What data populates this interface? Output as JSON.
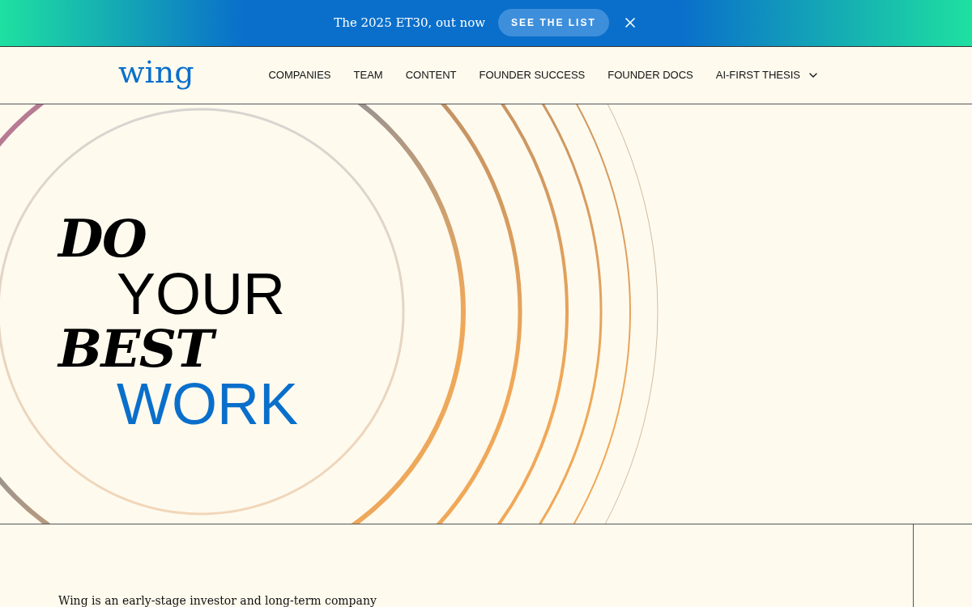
{
  "banner": {
    "text": "The 2025 ET30, out now",
    "button": "SEE THE LIST"
  },
  "header": {
    "logo": "wing",
    "nav": [
      {
        "label": "COMPANIES",
        "dropdown": false
      },
      {
        "label": "TEAM",
        "dropdown": false
      },
      {
        "label": "CONTENT",
        "dropdown": false
      },
      {
        "label": "FOUNDER SUCCESS",
        "dropdown": false
      },
      {
        "label": "FOUNDER DOCS",
        "dropdown": false
      },
      {
        "label": "AI-FIRST THESIS",
        "dropdown": true
      }
    ]
  },
  "hero": {
    "lines": [
      {
        "text": "DO",
        "kind": "serif"
      },
      {
        "text": "YOUR",
        "kind": "sans"
      },
      {
        "text": "BEST",
        "kind": "serif"
      },
      {
        "text": "WORK",
        "kind": "accent"
      }
    ]
  },
  "intro": {
    "text": "Wing is an early-stage investor and long-term company"
  }
}
